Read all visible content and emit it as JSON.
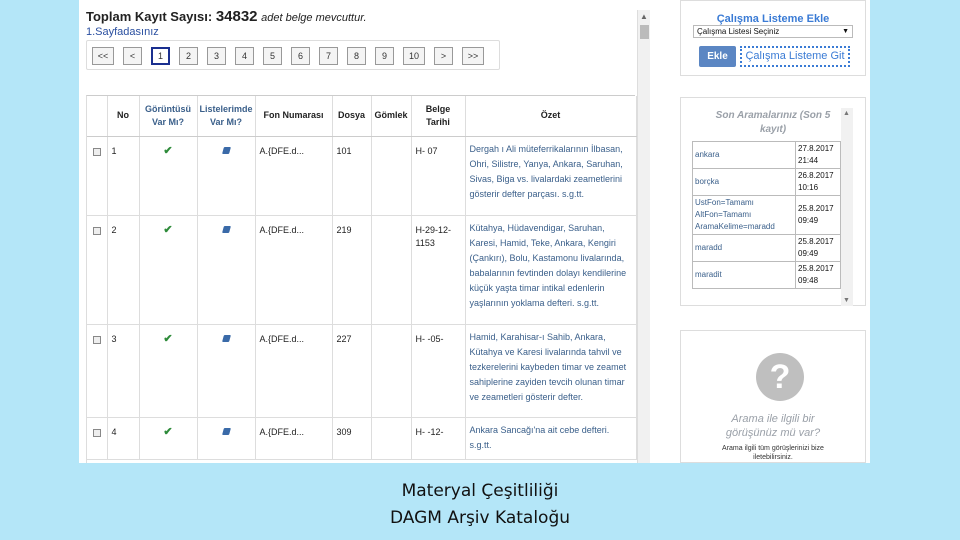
{
  "header": {
    "total_label": "Toplam Kayıt Sayısı:",
    "total_value": "34832",
    "total_suffix": "adet belge mevcuttur.",
    "page_label": "1.Sayfadasınız"
  },
  "pagination": {
    "first": "<<",
    "prev": "<",
    "pages": [
      "1",
      "2",
      "3",
      "4",
      "5",
      "6",
      "7",
      "8",
      "9",
      "10"
    ],
    "active": "1",
    "next": ">",
    "last": ">>"
  },
  "table": {
    "headers": {
      "no": "No",
      "viewed_l1": "Görüntüsü",
      "viewed_l2": "Var Mı?",
      "listed_l1": "Listelerimde",
      "listed_l2": "Var Mı?",
      "fon": "Fon Numarası",
      "dosya": "Dosya",
      "gomlek": "Gömlek",
      "tarih_l1": "Belge",
      "tarih_l2": "Tarihi",
      "ozet": "Özet"
    },
    "rows": [
      {
        "no": "1",
        "fon": "A.{DFE.d...",
        "dosya": "101",
        "gomlek": "",
        "tarih": "H- 07",
        "ozet": "Dergah ı Ali müteferrikalarının İlbasan, Ohri, Silistre, Yanya, Ankara, Saruhan, Sivas, Biga vs. livalardaki zeametlerini gösterir defter parçası. s.g.tt."
      },
      {
        "no": "2",
        "fon": "A.{DFE.d...",
        "dosya": "219",
        "gomlek": "",
        "tarih": "H-29-12-1153",
        "ozet": "Kütahya, Hüdavendigar, Saruhan, Karesi, Hamid, Teke, Ankara, Kengiri (Çankırı), Bolu, Kastamonu livalarında, babalarının fevtinden dolayı kendilerine küçük yaşta timar intikal edenlerin yaşlarının yoklama defteri. s.g.tt."
      },
      {
        "no": "3",
        "fon": "A.{DFE.d...",
        "dosya": "227",
        "gomlek": "",
        "tarih": "H- -05-",
        "ozet": "Hamid, Karahisar-ı Sahib, Ankara, Kütahya ve Karesi livalarında tahvil ve tezkerelerini kaybeden timar ve zeamet sahiplerine zayiden tevcih olunan timar ve zeametleri gösterir defter."
      },
      {
        "no": "4",
        "fon": "A.{DFE.d...",
        "dosya": "309",
        "gomlek": "",
        "tarih": "H- -12-",
        "ozet": "Ankara Sancağı'na ait cebe defteri. s.g.tt."
      }
    ]
  },
  "worklist": {
    "title": "Çalışma Listeme Ekle",
    "select_value": "Çalışma Listesi Seçiniz",
    "add_button": "Ekle",
    "go_button": "Çalışma Listeme Git"
  },
  "recent": {
    "title_l1": "Son Aramalarınız (Son 5",
    "title_l2": "kayıt)",
    "items": [
      {
        "query": "ankara",
        "date": "27.8.2017",
        "time": "21:44"
      },
      {
        "query": "borçka",
        "date": "26.8.2017",
        "time": "10:16"
      },
      {
        "query_l1": "UstFon=Tamamı",
        "query_l2": "AltFon=Tamamı",
        "query_l3": "AramaKelime=maradd",
        "date": "25.8.2017",
        "time": "09:49"
      },
      {
        "query": "maradd",
        "date": "25.8.2017",
        "time": "09:49"
      },
      {
        "query": "maradit",
        "date": "25.8.2017",
        "time": "09:48"
      }
    ]
  },
  "help": {
    "icon": "question-icon",
    "line1": "Arama ile ilgili bir",
    "line2": "görüşünüz mü var?",
    "line3": "Arama ilgili tüm görüşlerinizi bize",
    "line4": "iletebilirsiniz."
  },
  "caption": {
    "line1": "Materyal Çeşitliliği",
    "line2": "DAGM Arşiv Kataloğu"
  }
}
